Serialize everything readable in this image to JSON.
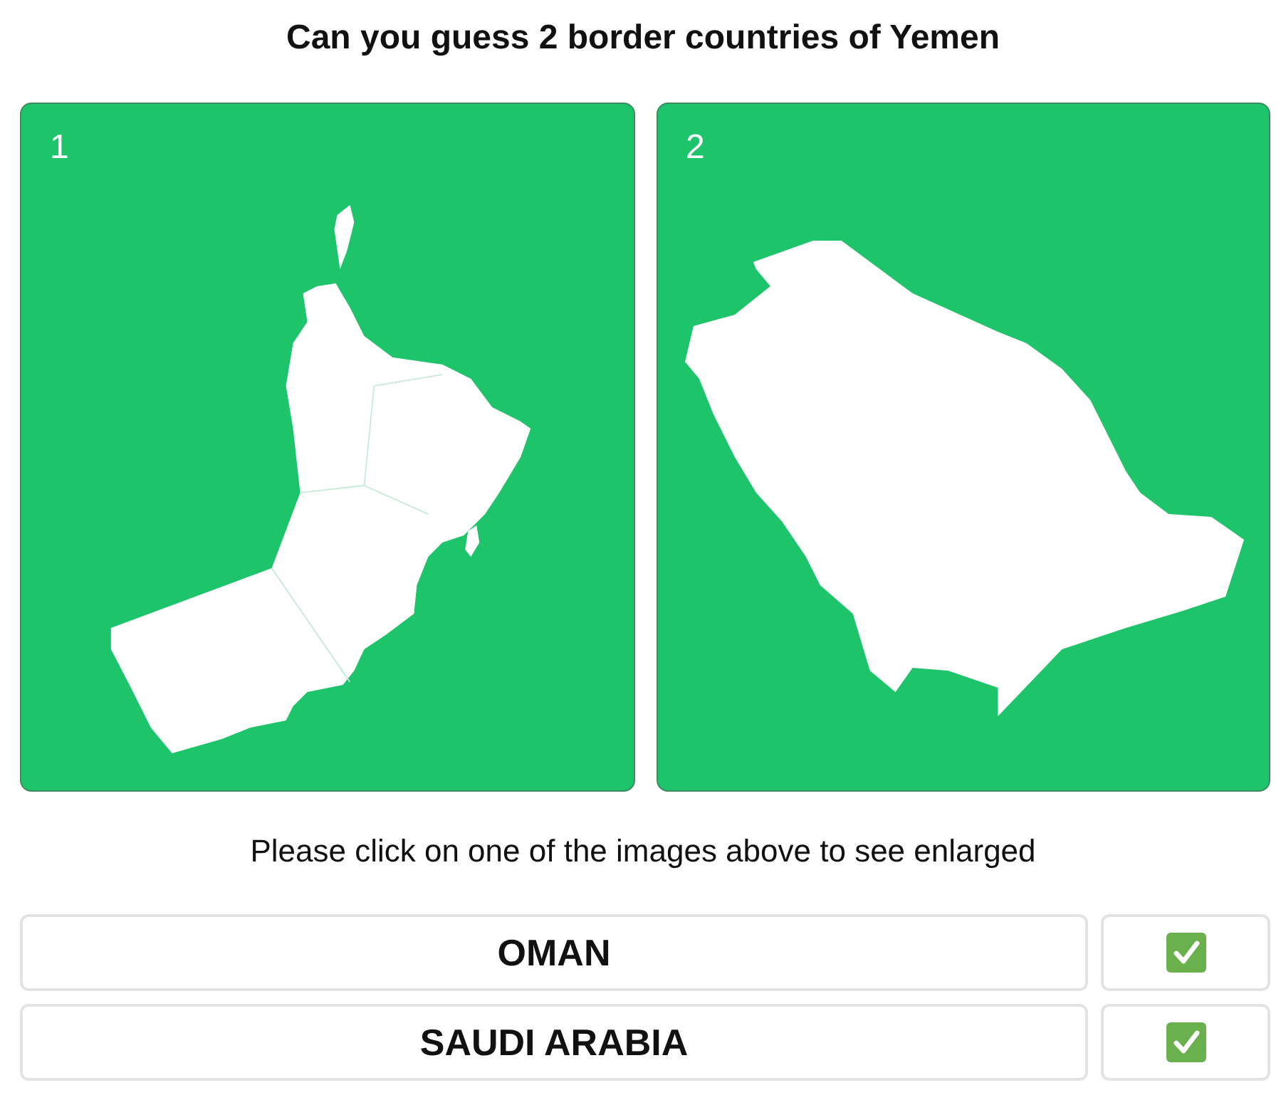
{
  "title": "Can you guess 2 border countries of Yemen",
  "maps": [
    {
      "number": "1"
    },
    {
      "number": "2"
    }
  ],
  "instruction": "Please click on one of the images above to see enlarged",
  "answers": [
    {
      "name": "OMAN",
      "correct": true
    },
    {
      "name": "SAUDI ARABIA",
      "correct": true
    }
  ]
}
